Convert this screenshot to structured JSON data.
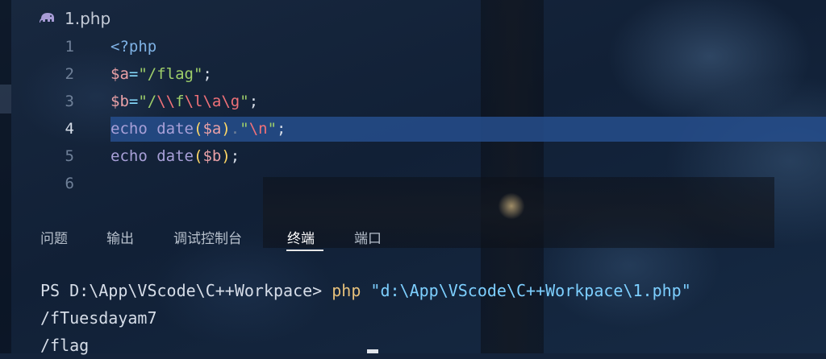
{
  "tab": {
    "label": "1.php",
    "icon": "elephant-icon",
    "icon_color": "#a79bd6"
  },
  "editor": {
    "lines": [
      {
        "num": "1",
        "tokens": [
          {
            "t": "<?php",
            "c": "tag"
          }
        ]
      },
      {
        "num": "2",
        "tokens": [
          {
            "t": "$a",
            "c": "var"
          },
          {
            "t": "=",
            "c": "op"
          },
          {
            "t": "\"/flag\"",
            "c": "str"
          },
          {
            "t": ";",
            "c": "semi"
          }
        ]
      },
      {
        "num": "3",
        "tokens": [
          {
            "t": "$b",
            "c": "var"
          },
          {
            "t": "=",
            "c": "op"
          },
          {
            "t": "\"/",
            "c": "str"
          },
          {
            "t": "\\\\",
            "c": "esc"
          },
          {
            "t": "f",
            "c": "str"
          },
          {
            "t": "\\l",
            "c": "esc"
          },
          {
            "t": "\\a",
            "c": "esc"
          },
          {
            "t": "\\g",
            "c": "esc"
          },
          {
            "t": "\"",
            "c": "str"
          },
          {
            "t": ";",
            "c": "semi"
          }
        ]
      },
      {
        "num": "4",
        "active": true,
        "tokens": [
          {
            "t": "echo",
            "c": "kw"
          },
          {
            "t": " ",
            "c": "semi"
          },
          {
            "t": "date",
            "c": "fn"
          },
          {
            "t": "(",
            "c": "par"
          },
          {
            "t": "$a",
            "c": "var"
          },
          {
            "t": ")",
            "c": "par"
          },
          {
            "t": ".",
            "c": "dot"
          },
          {
            "t": "\"",
            "c": "str"
          },
          {
            "t": "\\n",
            "c": "esc"
          },
          {
            "t": "\"",
            "c": "str"
          },
          {
            "t": ";",
            "c": "semi"
          }
        ]
      },
      {
        "num": "5",
        "tokens": [
          {
            "t": "echo",
            "c": "kw"
          },
          {
            "t": " ",
            "c": "semi"
          },
          {
            "t": "date",
            "c": "fn"
          },
          {
            "t": "(",
            "c": "par"
          },
          {
            "t": "$b",
            "c": "var"
          },
          {
            "t": ")",
            "c": "par"
          },
          {
            "t": ";",
            "c": "semi"
          }
        ]
      },
      {
        "num": "6",
        "tokens": []
      }
    ]
  },
  "panel": {
    "tabs": [
      {
        "label": "问题"
      },
      {
        "label": "输出"
      },
      {
        "label": "调试控制台"
      },
      {
        "label": "终端",
        "active": true
      },
      {
        "label": "端口"
      }
    ]
  },
  "terminal": {
    "prompt": "PS D:\\App\\VScode\\C++Workpace> ",
    "command": "php",
    "argument": " \"d:\\App\\VScode\\C++Workpace\\1.php\"",
    "outputs": [
      "/fTuesdayam7",
      "/flag"
    ]
  },
  "colors": {
    "background": "#14233a",
    "line_highlight": "#264e8c",
    "string": "#9ece6a",
    "variable": "#e8a0a6",
    "escape": "#f07178",
    "keyword": "#a8a0d8",
    "paren": "#ffd866",
    "command": "#e5c07b",
    "argument": "#7dcfff"
  }
}
